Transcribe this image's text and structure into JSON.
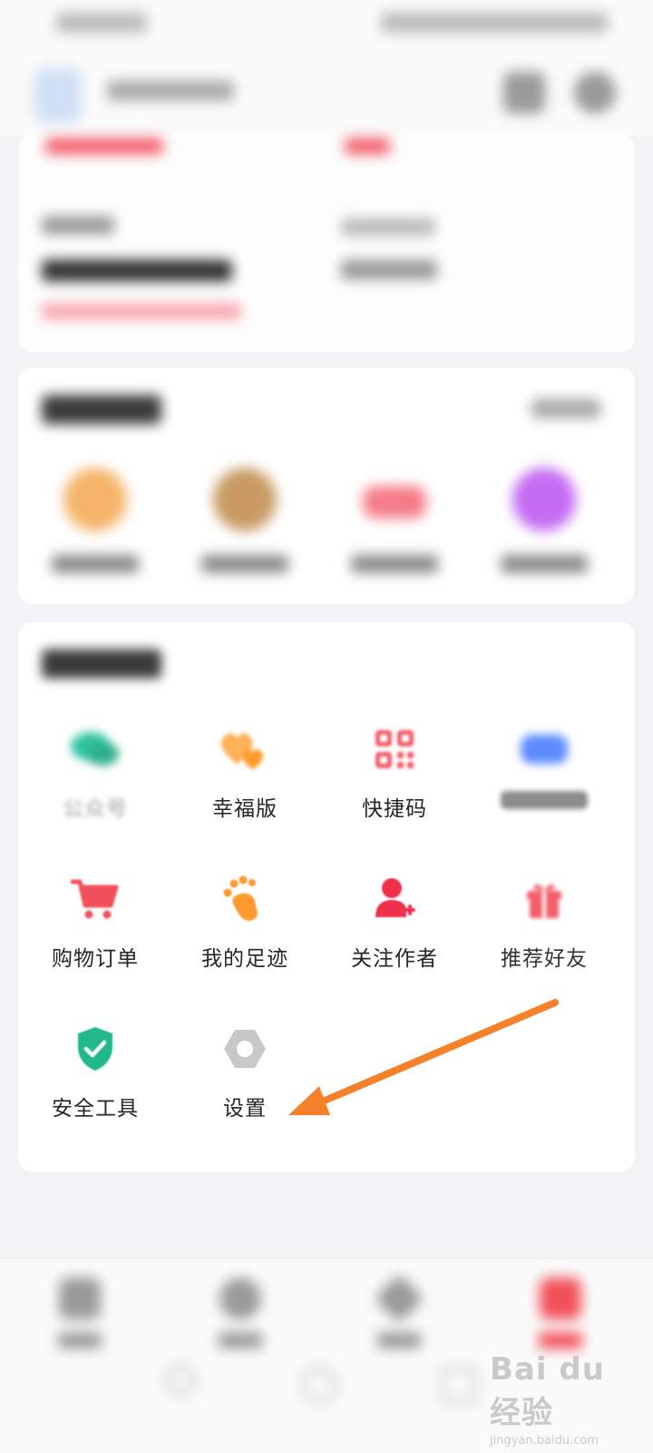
{
  "basic_services": {
    "items": [
      {
        "name": "official-account",
        "label": "公众号",
        "icon": "chat-bubble-icon",
        "color": "#33c4a0",
        "faded": true
      },
      {
        "name": "happy-edition",
        "label": "幸福版",
        "icon": "hearts-icon",
        "color": "#ffa447",
        "faded": false
      },
      {
        "name": "quick-code",
        "label": "快捷码",
        "icon": "qr-code-icon",
        "color": "#f25e6a",
        "faded": false
      },
      {
        "name": "unclear",
        "label": "",
        "icon": "ticket-icon",
        "color": "#5b8cff",
        "faded": true
      },
      {
        "name": "shopping-orders",
        "label": "购物订单",
        "icon": "shopping-cart-icon",
        "color": "#f25059",
        "faded": false
      },
      {
        "name": "my-footprints",
        "label": "我的足迹",
        "icon": "footprint-icon",
        "color": "#ff9a2e",
        "faded": false
      },
      {
        "name": "follow-authors",
        "label": "关注作者",
        "icon": "user-plus-icon",
        "color": "#f0304a",
        "faded": false
      },
      {
        "name": "recommend-friends",
        "label": "推荐好友",
        "icon": "gift-icon",
        "color": "#f25e6a",
        "faded": false
      },
      {
        "name": "security-tools",
        "label": "安全工具",
        "icon": "shield-check-icon",
        "color": "#21b98c",
        "faded": false
      },
      {
        "name": "settings",
        "label": "设置",
        "icon": "hexagon-nut-icon",
        "color": "#c4c4c4",
        "faded": false
      }
    ]
  },
  "watermark": {
    "logo": "Bai du 经验",
    "sub": "jingyan.baidu.com"
  },
  "colors": {
    "background": "#f3f3f5",
    "card": "#ffffff",
    "annotation_arrow": "#f5822a",
    "accent_red": "#f25059"
  }
}
